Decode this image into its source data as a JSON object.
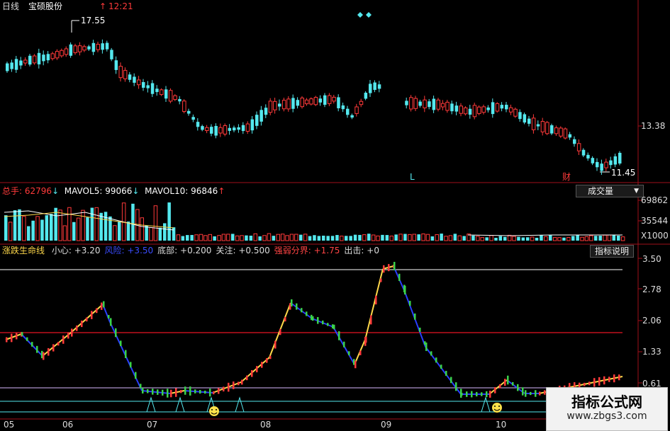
{
  "header": {
    "period": "日线",
    "stock_name": "宝硕股份",
    "time": "12:21",
    "time_arrow": "↑"
  },
  "price_panel": {
    "high_label": "17.55",
    "low_label": "11.45",
    "axis_label": "13.38",
    "marker_l": "L",
    "marker_cai": "财"
  },
  "volume_panel": {
    "label_total": "总手",
    "value_total": "62796",
    "arrow_total": "↓",
    "label_ma5": "MAVOL5",
    "value_ma5": "99066",
    "arrow_ma5": "↓",
    "label_ma10": "MAVOL10",
    "value_ma10": "96846",
    "arrow_ma10": "↑",
    "button": "成交量",
    "dropdown_icon": "▼",
    "axis_top": "69862",
    "axis_mid": "35544",
    "axis_unit": "X1000"
  },
  "indicator_panel": {
    "name": "涨跌生命线",
    "params": [
      {
        "label": "小心",
        "value": "+3.20",
        "color": "#dddddd"
      },
      {
        "label": "风险",
        "value": "+3.50",
        "color": "#3a4cff"
      },
      {
        "label": "底部",
        "value": "+0.200",
        "color": "#dddddd"
      },
      {
        "label": "关注",
        "value": "+0.500",
        "color": "#dddddd"
      },
      {
        "label": "强弱分界",
        "value": "+1.75",
        "color": "#ff4444"
      },
      {
        "label": "出击",
        "value": "+0",
        "color": "#dddddd"
      }
    ],
    "button": "指标说明",
    "axis_labels": [
      "3.50",
      "2.78",
      "2.06",
      "1.33",
      "0.61"
    ]
  },
  "x_axis_labels": [
    "05",
    "06",
    "07",
    "08",
    "09",
    "10"
  ],
  "watermark": {
    "title": "指标公式网",
    "url": "www.zbgs3.com"
  },
  "colors": {
    "up": "#ff3a3a",
    "down": "#54e8ee",
    "yellow": "#ffd84a",
    "blue": "#2a3fff",
    "red_line": "#c0101e"
  }
}
